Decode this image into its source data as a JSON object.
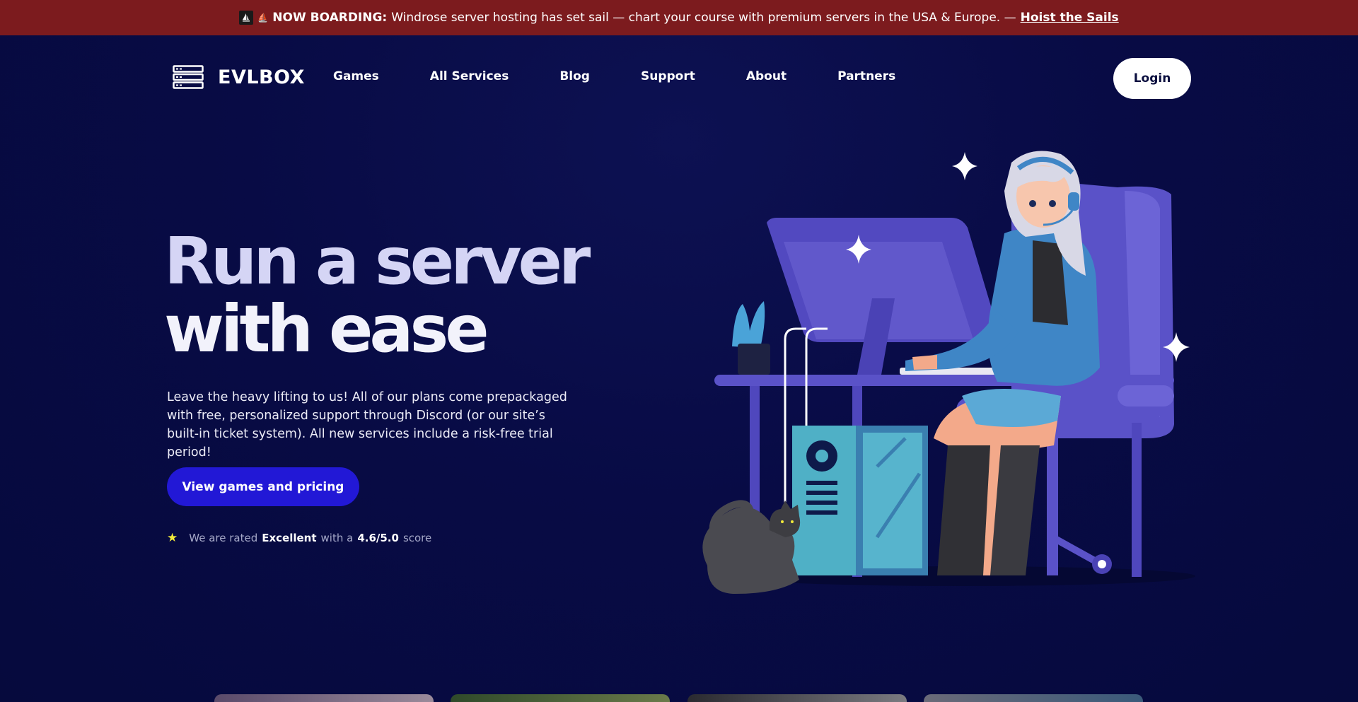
{
  "announcement": {
    "icon": "sailboat-icon",
    "glyph": "⛵",
    "prefix": "NOW BOARDING:",
    "message": "Windrose server hosting has set sail — chart your course with premium servers in the USA & Europe. —",
    "link_label": "Hoist the Sails",
    "background": "#7c1b1e"
  },
  "brand": {
    "name": "EVLBOX",
    "icon": "server-rack-icon"
  },
  "nav": {
    "items": [
      {
        "label": "Games"
      },
      {
        "label": "All Services"
      },
      {
        "label": "Blog"
      },
      {
        "label": "Support"
      },
      {
        "label": "About"
      },
      {
        "label": "Partners"
      }
    ],
    "login_label": "Login"
  },
  "hero": {
    "title_line1": "Run a server",
    "title_line2": "with ease",
    "description": "Leave the heavy lifting to us! All of our plans come prepackaged with free, personalized support through Discord (or our site’s built-in ticket system). All new services include a risk-free trial period!",
    "cta_label": "View games and pricing",
    "cta_color": "#2218d6"
  },
  "rating": {
    "icon": "star-icon",
    "prefix": "We are rated",
    "grade": "Excellent",
    "middle": "with a",
    "score": "4.6/5.0",
    "suffix": "score"
  },
  "colors": {
    "background": "#080b45",
    "accent_purple": "#5a52c8",
    "accent_teal": "#4ab3c9"
  }
}
